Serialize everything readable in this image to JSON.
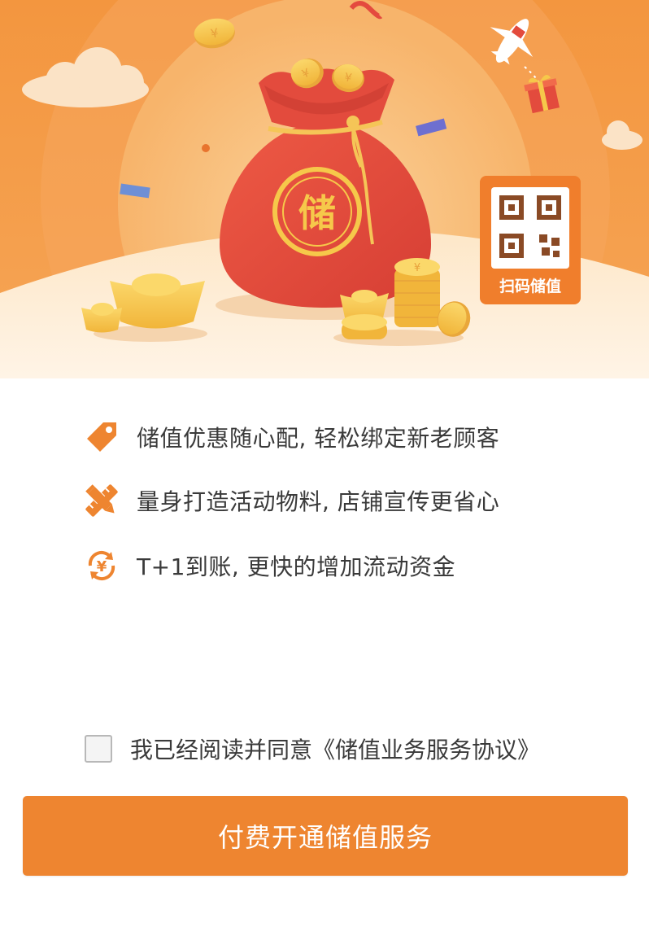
{
  "banner": {
    "bag_character": "储",
    "qr_badge_label": "扫码储值",
    "colors": {
      "background": "#f08a33",
      "bag": "#e34b3d",
      "gold": "#f6c84a",
      "badge": "#f07e2c"
    }
  },
  "features": [
    {
      "icon": "price-tag-icon",
      "text": "储值优惠随心配, 轻松绑定新老顾客"
    },
    {
      "icon": "ruler-pencil-icon",
      "text": "量身打造活动物料, 店铺宣传更省心"
    },
    {
      "icon": "yuan-cycle-icon",
      "text": "T+1到账, 更快的增加流动资金"
    }
  ],
  "agreement": {
    "checked": false,
    "text": "我已经阅读并同意《储值业务服务协议》"
  },
  "pay_button": {
    "label": "付费开通储值服务",
    "color": "#ee8530"
  },
  "accent_color": "#ee8530"
}
